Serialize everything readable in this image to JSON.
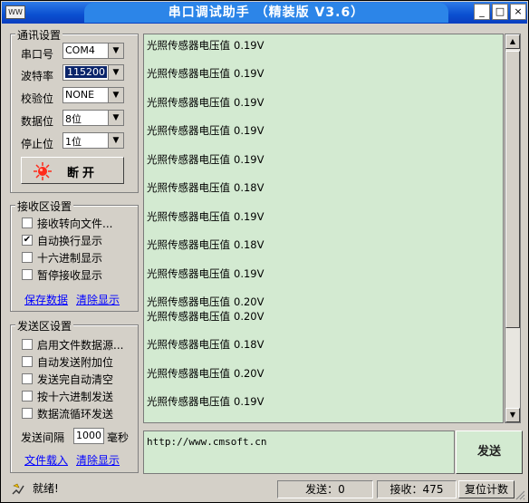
{
  "window": {
    "title": "串口调试助手 （精装版 V3.6）",
    "icon_text": "WW",
    "controls": {
      "minimize": "_",
      "maximize": "□",
      "close": "×"
    }
  },
  "comm_settings": {
    "title": "通讯设置",
    "port": {
      "label": "串口号",
      "value": "COM4"
    },
    "baud": {
      "label": "波特率",
      "value": "115200"
    },
    "parity": {
      "label": "校验位",
      "value": "NONE"
    },
    "data_bits": {
      "label": "数据位",
      "value": "8位"
    },
    "stop_bits": {
      "label": "停止位",
      "value": "1位"
    },
    "toggle_button": {
      "label": "断开"
    }
  },
  "receive_settings": {
    "title": "接收区设置",
    "options": [
      {
        "label": "接收转向文件...",
        "checked": false
      },
      {
        "label": "自动换行显示",
        "checked": true
      },
      {
        "label": "十六进制显示",
        "checked": false
      },
      {
        "label": "暂停接收显示",
        "checked": false
      }
    ],
    "save_link": "保存数据",
    "clear_link": "清除显示"
  },
  "send_settings": {
    "title": "发送区设置",
    "options": [
      {
        "label": "启用文件数据源...",
        "checked": false
      },
      {
        "label": "自动发送附加位",
        "checked": false
      },
      {
        "label": "发送完自动清空",
        "checked": false
      },
      {
        "label": "按十六进制发送",
        "checked": false
      },
      {
        "label": "数据流循环发送",
        "checked": false
      }
    ],
    "interval_label": "发送间隔",
    "interval_value": "1000",
    "interval_unit": "毫秒",
    "load_file_link": "文件载入",
    "clear_link": "清除显示"
  },
  "receive_area": {
    "lines": [
      {
        "text": "光照传感器电压值",
        "value": "0.19V"
      },
      {
        "text": "光照传感器电压值",
        "value": "0.19V"
      },
      {
        "text": "光照传感器电压值",
        "value": "0.19V"
      },
      {
        "text": "光照传感器电压值",
        "value": "0.19V"
      },
      {
        "text": "光照传感器电压值",
        "value": "0.19V"
      },
      {
        "text": "光照传感器电压值",
        "value": "0.18V"
      },
      {
        "text": "光照传感器电压值",
        "value": "0.19V"
      },
      {
        "text": "光照传感器电压值",
        "value": "0.18V"
      },
      {
        "text": "光照传感器电压值",
        "value": "0.19V"
      },
      {
        "text": "光照传感器电压值",
        "value": "0.20V"
      },
      {
        "text": "光照传感器电压值",
        "value": "0.20V"
      },
      {
        "text": "光照传感器电压值",
        "value": "0.18V"
      },
      {
        "text": "光照传感器电压值",
        "value": "0.20V"
      },
      {
        "text": "光照传感器电压值",
        "value": "0.19V"
      }
    ]
  },
  "send_area": {
    "text": "http://www.cmsoft.cn",
    "send_button": "发送"
  },
  "status_bar": {
    "status": "就绪!",
    "sent": "发送：0",
    "received": "接收：475",
    "reset": "复位计数"
  },
  "colors": {
    "title_bar": "#0a4fd0",
    "text_area_bg": "#d3ead1",
    "link": "#0000ff",
    "selection": "#0a246a",
    "led": "#ff2a1a"
  }
}
